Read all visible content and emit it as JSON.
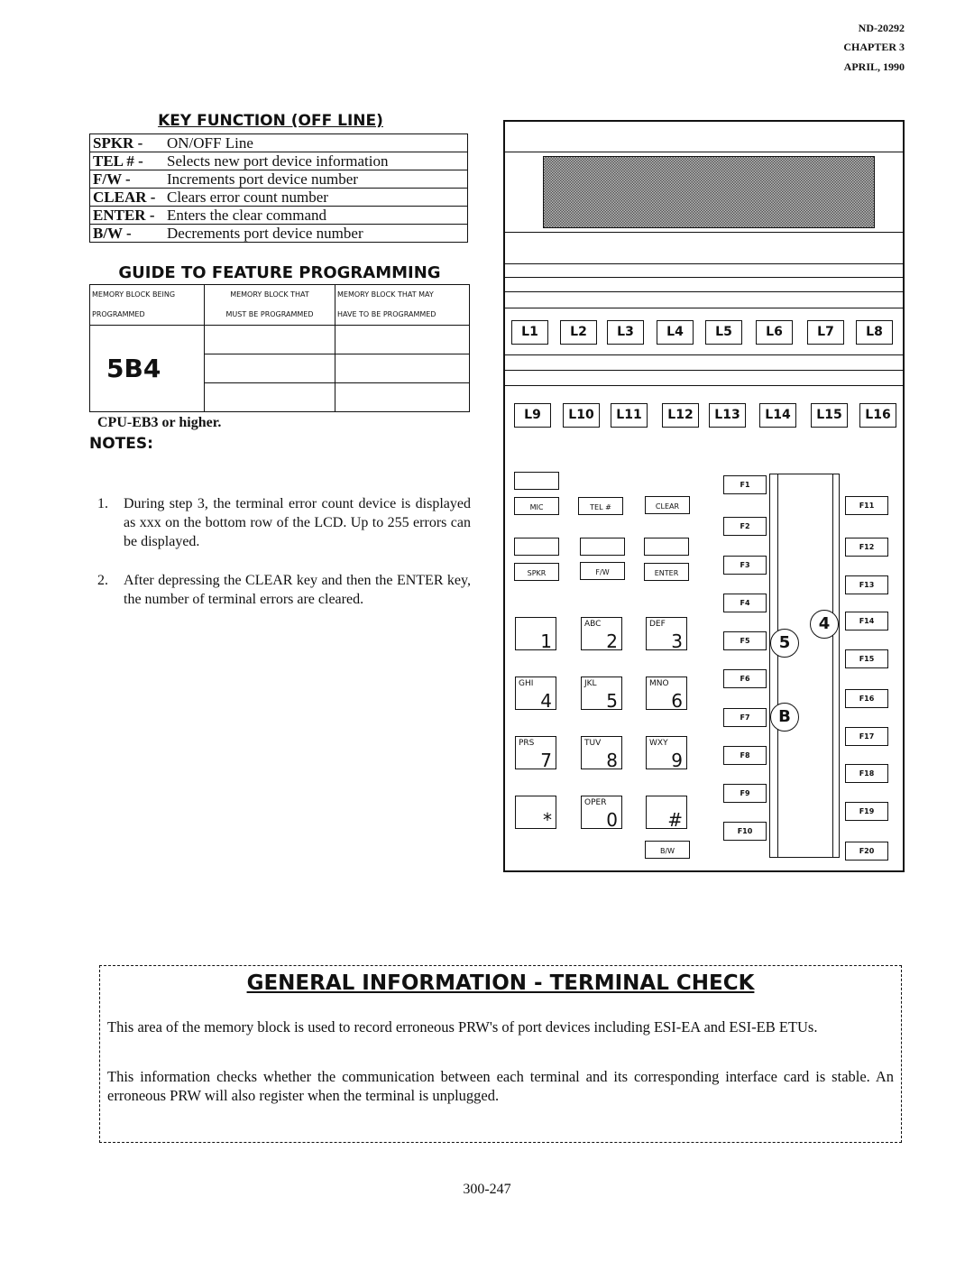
{
  "header": {
    "doc_id": "ND-20292",
    "chapter": "CHAPTER 3",
    "date": "APRIL, 1990"
  },
  "key_function": {
    "title": "KEY FUNCTION (OFF LINE)",
    "rows": [
      {
        "key": "SPKR -",
        "desc": "ON/OFF Line"
      },
      {
        "key": "TEL # -",
        "desc": "Selects new port device information"
      },
      {
        "key": "F/W -",
        "desc": "Increments port device number"
      },
      {
        "key": "CLEAR -",
        "desc": "Clears error count number"
      },
      {
        "key": "ENTER -",
        "desc": "Enters the clear command"
      },
      {
        "key": "B/W -",
        "desc": "Decrements port device number"
      }
    ]
  },
  "guide": {
    "title": "GUIDE TO FEATURE PROGRAMMING",
    "col1": [
      "MEMORY BLOCK BEING",
      "PROGRAMMED"
    ],
    "col2": [
      "MEMORY BLOCK THAT",
      "MUST BE PROGRAMMED"
    ],
    "col3": [
      "MEMORY BLOCK THAT MAY",
      "HAVE TO BE PROGRAMMED"
    ],
    "block": "5B4"
  },
  "requirement": "CPU-EB3 or higher.",
  "notes": {
    "title": "NOTES:",
    "items": [
      {
        "num": "1.",
        "text": "During step 3, the terminal error count device is displayed as xxx on the bottom row of the LCD. Up to 255 errors can be displayed."
      },
      {
        "num": "2.",
        "text": "After depressing the CLEAR key and then the ENTER key, the number of terminal errors are cleared."
      }
    ]
  },
  "phone": {
    "line_keys": [
      "L1",
      "L2",
      "L3",
      "L4",
      "L5",
      "L6",
      "L7",
      "L8",
      "L9",
      "L10",
      "L11",
      "L12",
      "L13",
      "L14",
      "L15",
      "L16"
    ],
    "soft_keys": [
      "MIC",
      "TEL #",
      "CLEAR",
      "SPKR",
      "F/W",
      "ENTER",
      "B/W"
    ],
    "dial_keys": [
      {
        "l": "",
        "d": "1"
      },
      {
        "l": "ABC",
        "d": "2"
      },
      {
        "l": "DEF",
        "d": "3"
      },
      {
        "l": "GHI",
        "d": "4"
      },
      {
        "l": "JKL",
        "d": "5"
      },
      {
        "l": "MNO",
        "d": "6"
      },
      {
        "l": "PRS",
        "d": "7"
      },
      {
        "l": "TUV",
        "d": "8"
      },
      {
        "l": "WXY",
        "d": "9"
      },
      {
        "l": "",
        "d": "*"
      },
      {
        "l": "OPER",
        "d": "0"
      },
      {
        "l": "",
        "d": "#"
      }
    ],
    "function_keys": [
      "F1",
      "F2",
      "F3",
      "F4",
      "F5",
      "F6",
      "F7",
      "F8",
      "F9",
      "F10",
      "F11",
      "F12",
      "F13",
      "F14",
      "F15",
      "F16",
      "F17",
      "F18",
      "F19",
      "F20"
    ],
    "callouts": [
      "4",
      "5",
      "B"
    ]
  },
  "general_info": {
    "title": "GENERAL INFORMATION - TERMINAL CHECK",
    "paragraphs": [
      "This area of the memory block is used to record erroneous PRW's of port devices including ESI-EA and ESI-EB ETUs.",
      "This information checks whether the communication between each terminal and its corresponding interface card is stable. An erroneous PRW will also register when the terminal is unplugged."
    ]
  },
  "page_number": "300-247"
}
